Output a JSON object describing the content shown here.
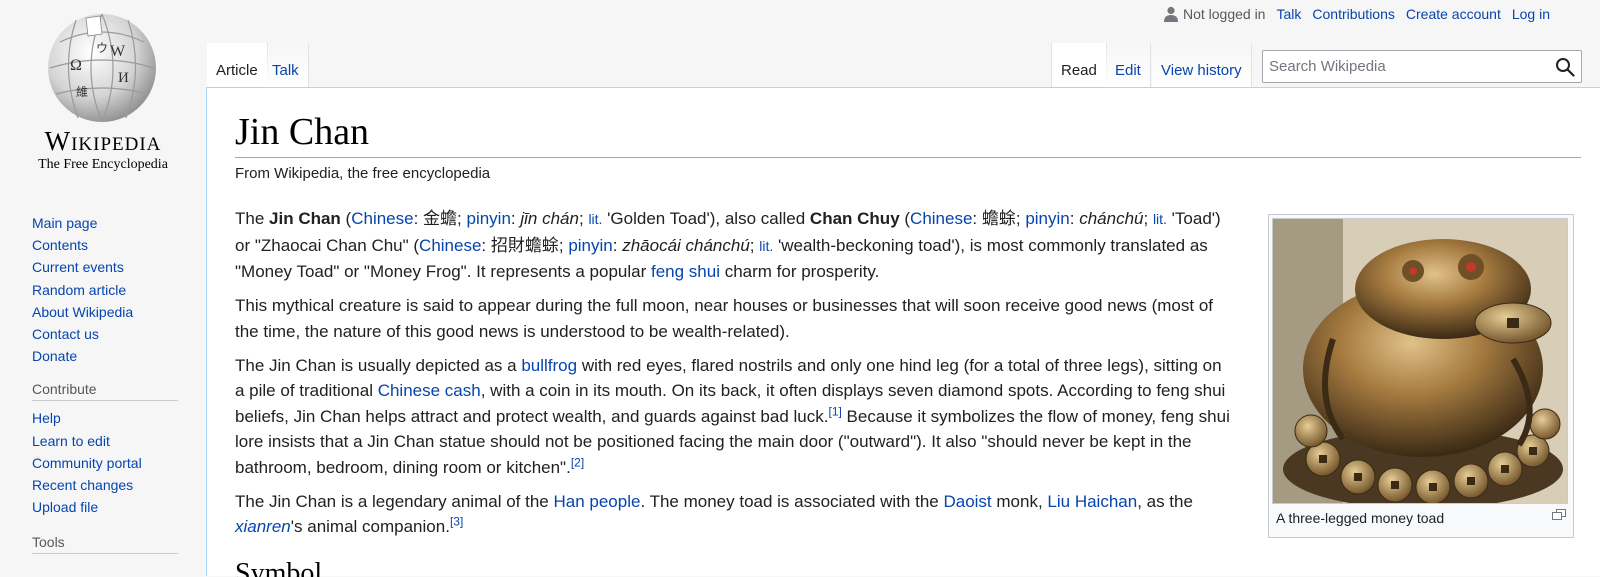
{
  "logo": {
    "wordmark": "Wikipedia",
    "tagline": "The Free Encyclopedia"
  },
  "sidebar": {
    "main_nav": [
      {
        "label": "Main page"
      },
      {
        "label": "Contents"
      },
      {
        "label": "Current events"
      },
      {
        "label": "Random article"
      },
      {
        "label": "About Wikipedia"
      },
      {
        "label": "Contact us"
      },
      {
        "label": "Donate"
      }
    ],
    "contribute": {
      "heading": "Contribute",
      "items": [
        {
          "label": "Help"
        },
        {
          "label": "Learn to edit"
        },
        {
          "label": "Community portal"
        },
        {
          "label": "Recent changes"
        },
        {
          "label": "Upload file"
        }
      ]
    },
    "tools": {
      "heading": "Tools"
    }
  },
  "personal": {
    "not_logged_in": "Not logged in",
    "talk": "Talk",
    "contributions": "Contributions",
    "create_account": "Create account",
    "log_in": "Log in"
  },
  "tabs": {
    "article": "Article",
    "talk": "Talk",
    "read": "Read",
    "edit": "Edit",
    "view_history": "View history"
  },
  "search": {
    "placeholder": "Search Wikipedia",
    "value": ""
  },
  "article": {
    "title": "Jin Chan",
    "site_sub": "From Wikipedia, the free encyclopedia",
    "p1": {
      "the": "The ",
      "jin_chan": "Jin Chan",
      "open1": " (",
      "chinese": "Chinese",
      "colon1": ": ",
      "hanzi1": "金蟾",
      "semi1": "; ",
      "pinyin": "pinyin",
      "colon2": ": ",
      "py1": "jīn chán",
      "semi2": "; ",
      "lit": "lit.",
      "gloss1": " 'Golden Toad'), also called ",
      "chan_chuy": "Chan Chuy",
      "open2": " (",
      "colon3": ": ",
      "hanzi2": "蟾蜍",
      "semi3": "; ",
      "colon4": ": ",
      "py2": "chánchú",
      "semi4": "; ",
      "gloss2": " 'Toad') or \"Zhaocai Chan Chu\" (",
      "colon5": ": ",
      "hanzi3": "招財蟾蜍",
      "semi5": "; ",
      "colon6": ": ",
      "py3": "zhāocái chánchú",
      "semi6": "; ",
      "gloss3": " 'wealth-beckoning toad'), is most commonly translated as \"Money Toad\" or \"Money Frog\". It represents a popular ",
      "feng_shui": "feng shui",
      "end": " charm for prosperity."
    },
    "p2": "This mythical creature is said to appear during the full moon, near houses or businesses that will soon receive good news (most of the time, the nature of this good news is understood to be wealth-related).",
    "p3": {
      "a": "The Jin Chan is usually depicted as a ",
      "bullfrog": "bullfrog",
      "b": " with red eyes, flared nostrils and only one hind leg (for a total of three legs), sitting on a pile of traditional ",
      "chinese_cash": "Chinese cash",
      "c": ", with a coin in its mouth. On its back, it often displays seven diamond spots. According to feng shui beliefs, Jin Chan helps attract and protect wealth, and guards against bad luck.",
      "ref1": "[1]",
      "d": " Because it symbolizes the flow of money, feng shui lore insists that a Jin Chan statue should not be positioned facing the main door (\"outward\"). It also \"should never be kept in the bathroom, bedroom, dining room or kitchen\".",
      "ref2": "[2]"
    },
    "p4": {
      "a": "The Jin Chan is a legendary animal of the ",
      "han_people": "Han people",
      "b": ". The money toad is associated with the ",
      "daoist": "Daoist",
      "c": " monk, ",
      "liu_haichan": "Liu Haichan",
      "d": ", as the ",
      "xianren": "xianren",
      "e": "'s animal companion.",
      "ref3": "[3]"
    },
    "thumb_caption": "A three-legged money toad",
    "next_heading": "Symbol"
  },
  "colors": {
    "link": "#0645ad",
    "text": "#202122",
    "border": "#a7d7f9"
  }
}
